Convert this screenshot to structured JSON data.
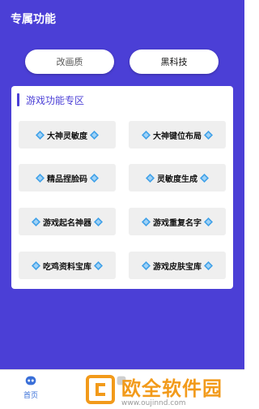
{
  "header": {
    "title": "专属功能"
  },
  "tabs_top": {
    "left": "改画质",
    "right": "黑科技"
  },
  "section": {
    "title": "游戏功能专区",
    "buttons": [
      "大神灵敏度",
      "大神键位布局",
      "精品捏脸码",
      "灵敏度生成",
      "游戏起名神器",
      "游戏重复名字",
      "吃鸡资料宝库",
      "游戏皮肤宝库"
    ]
  },
  "tabbar": {
    "home": "首页"
  },
  "watermark": {
    "name": "欧全软件园",
    "url": "www.oujinnd.com"
  },
  "colors": {
    "primary": "#4b3fd6",
    "diamond": "#3fa0e8",
    "watermark": "#f29a1a"
  }
}
